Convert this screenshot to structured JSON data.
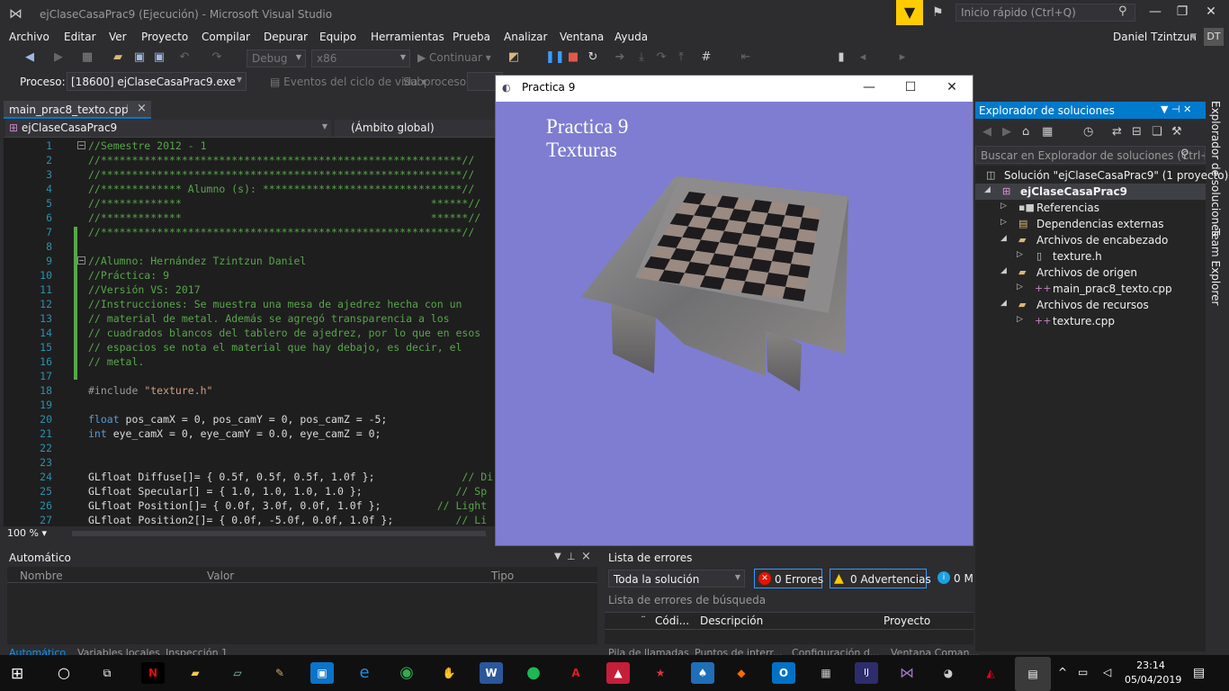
{
  "window": {
    "title": "ejClaseCasaPrac9 (Ejecución) - Microsoft Visual Studio",
    "quick_launch_placeholder": "Inicio rápido (Ctrl+Q)",
    "user_name": "Daniel Tzintzun",
    "user_initials": "DT"
  },
  "menu": [
    "Archivo",
    "Editar",
    "Ver",
    "Proyecto",
    "Compilar",
    "Depurar",
    "Equipo",
    "Herramientas",
    "Prueba",
    "Analizar",
    "Ventana",
    "Ayuda"
  ],
  "toolbar": {
    "config": "Debug",
    "platform": "x86",
    "continue_label": "Continuar",
    "process_label": "Proceso:",
    "process_value": "[18600] ejClaseCasaPrac9.exe",
    "lifecycle_label": "Eventos del ciclo de vida",
    "thread_label": "Subproceso:"
  },
  "editor": {
    "tab_label": "main_prac8_texto.cpp",
    "nav_project": "ejClaseCasaPrac9",
    "nav_scope": "(Ámbito global)",
    "zoom": "100 %",
    "lines": [
      {
        "n": "1",
        "t": "//Semestre 2012 - 1",
        "c": "cm"
      },
      {
        "n": "2",
        "t": "//**********************************************************//",
        "c": "cm"
      },
      {
        "n": "3",
        "t": "//**********************************************************//",
        "c": "cm"
      },
      {
        "n": "4",
        "t": "//************* Alumno (s): ********************************//",
        "c": "cm"
      },
      {
        "n": "5",
        "t": "//*************                                        ******//",
        "c": "cm"
      },
      {
        "n": "6",
        "t": "//*************                                        ******//",
        "c": "cm"
      },
      {
        "n": "7",
        "t": "//**********************************************************//",
        "c": "cm"
      },
      {
        "n": "8",
        "t": "",
        "c": "cm"
      },
      {
        "n": "9",
        "t": "//Alumno: Hernández Tzintzun Daniel",
        "c": "cm"
      },
      {
        "n": "10",
        "t": "//Práctica: 9",
        "c": "cm"
      },
      {
        "n": "11",
        "t": "//Versión VS: 2017",
        "c": "cm"
      },
      {
        "n": "12",
        "t": "//Instrucciones: Se muestra una mesa de ajedrez hecha con un",
        "c": "cm"
      },
      {
        "n": "13",
        "t": "// material de metal. Además se agregó transparencia a los",
        "c": "cm"
      },
      {
        "n": "14",
        "t": "// cuadrados blancos del tablero de ajedrez, por lo que en esos",
        "c": "cm"
      },
      {
        "n": "15",
        "t": "// espacios se nota el material que hay debajo, es decir, el",
        "c": "cm"
      },
      {
        "n": "16",
        "t": "// metal.",
        "c": "cm"
      },
      {
        "n": "17",
        "t": "",
        "c": "cm"
      },
      {
        "n": "18",
        "t": "#include \"texture.h\"",
        "c": "pp"
      },
      {
        "n": "19",
        "t": "",
        "c": "cm"
      },
      {
        "n": "20",
        "t": "float pos_camX = 0, pos_camY = 0, pos_camZ = -5;",
        "c": "code"
      },
      {
        "n": "21",
        "t": "int eye_camX = 0, eye_camY = 0.0, eye_camZ = 0;",
        "c": "code"
      },
      {
        "n": "22",
        "t": "",
        "c": "cm"
      },
      {
        "n": "23",
        "t": "",
        "c": "cm"
      },
      {
        "n": "24",
        "t": "GLfloat Diffuse[]= { 0.5f, 0.5f, 0.5f, 1.0f };              // Di",
        "c": "code"
      },
      {
        "n": "25",
        "t": "GLfloat Specular[] = { 1.0, 1.0, 1.0, 1.0 };               // Sp",
        "c": "code"
      },
      {
        "n": "26",
        "t": "GLfloat Position[]= { 0.0f, 3.0f, 0.0f, 1.0f };         // Light",
        "c": "code"
      },
      {
        "n": "27",
        "t": "GLfloat Position2[]= { 0.0f, -5.0f, 0.0f, 1.0f };          // Li",
        "c": "code"
      }
    ]
  },
  "auto_panel": {
    "title": "Automático",
    "columns": [
      "Nombre",
      "Valor",
      "Tipo"
    ]
  },
  "bottom_tabs": [
    "Automático",
    "Variables locales",
    "Inspección 1",
    "Pila de llamadas",
    "Puntos de interr...",
    "Configuración d...",
    "Ventana Coman..."
  ],
  "error_list": {
    "title": "Lista de errores",
    "scope": "Toda la solución",
    "errors": "0 Errores",
    "warnings": "0 Advertencias",
    "messages": "0 M",
    "search": "Lista de errores de búsqueda",
    "columns": [
      "Códi...",
      "Descripción",
      "Proyecto"
    ]
  },
  "gl_window": {
    "title": "Practica 9",
    "line1": "Practica 9",
    "line2": "Texturas",
    "background": "#7e7dd1"
  },
  "solution_explorer": {
    "title": "Explorador de soluciones",
    "search_placeholder": "Buscar en Explorador de soluciones (Ctrl+",
    "items": [
      {
        "label": "Solución \"ejClaseCasaPrac9\"  (1 proyecto)",
        "icon": "solution-icon"
      },
      {
        "label": "ejClaseCasaPrac9",
        "icon": "project-icon"
      },
      {
        "label": "Referencias",
        "icon": "references-icon"
      },
      {
        "label": "Dependencias externas",
        "icon": "dependencies-icon"
      },
      {
        "label": "Archivos de encabezado",
        "icon": "folder-icon"
      },
      {
        "label": "texture.h",
        "icon": "header-file-icon"
      },
      {
        "label": "Archivos de origen",
        "icon": "folder-icon"
      },
      {
        "label": "main_prac8_texto.cpp",
        "icon": "cpp-file-icon"
      },
      {
        "label": "Archivos de recursos",
        "icon": "folder-icon"
      },
      {
        "label": "texture.cpp",
        "icon": "cpp-file-icon"
      }
    ],
    "side_tabs": [
      "Explorador de soluciones",
      "Team Explorer"
    ]
  },
  "taskbar": {
    "time": "23:14",
    "date": "05/04/2019"
  },
  "colors": {
    "accent": "#007acc",
    "ide_bg": "#2d2d30",
    "editor_bg": "#1e1e1e",
    "gl_bg": "#7e7dd1"
  }
}
